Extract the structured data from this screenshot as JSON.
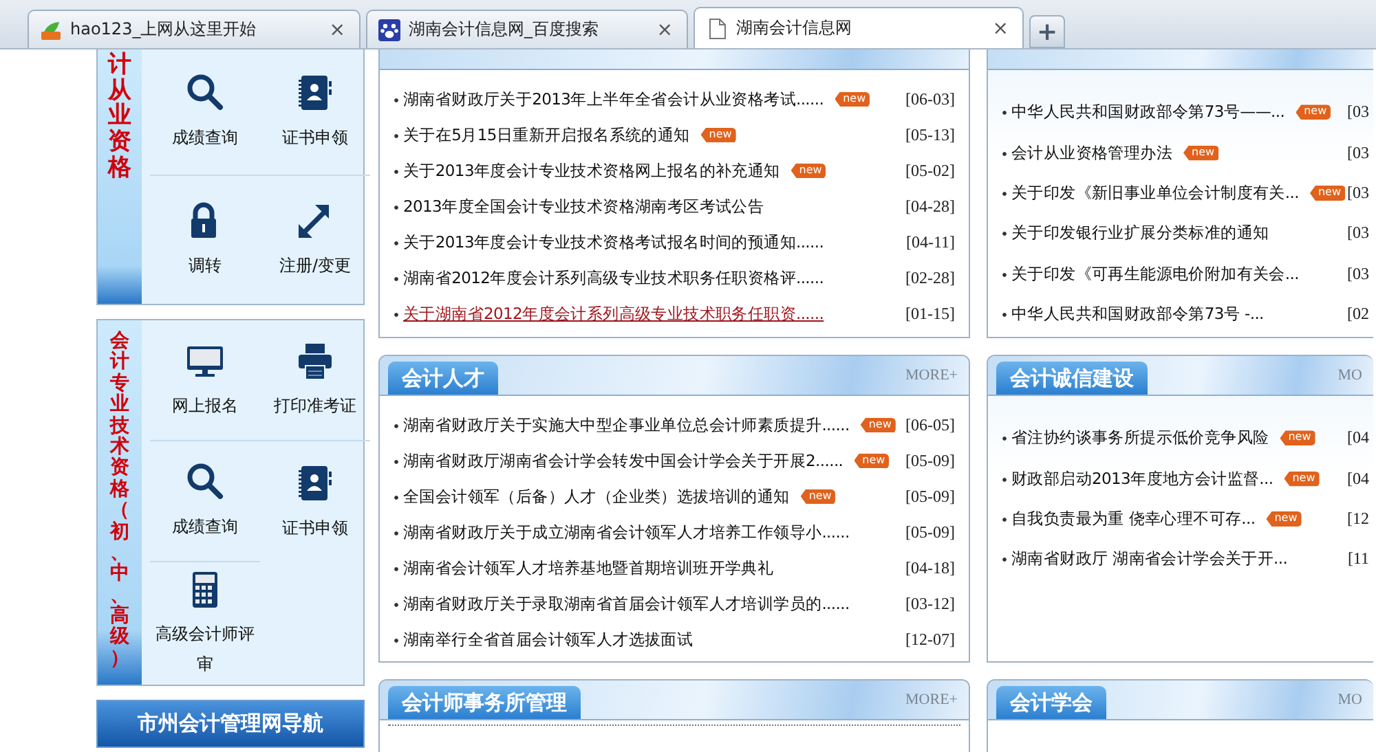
{
  "browser": {
    "tabs": [
      {
        "kind": "hao",
        "title": "hao123_上网从这里开始",
        "close": "×",
        "selected": false
      },
      {
        "kind": "paw",
        "title": "湖南会计信息网_百度搜索",
        "close": "×",
        "selected": false
      },
      {
        "kind": "page",
        "title": "湖南会计信息网",
        "close": "×",
        "selected": true
      }
    ],
    "new_tab": "+"
  },
  "sidebar": {
    "groups": [
      {
        "label": "计从业资格",
        "items": [
          {
            "kind": "search",
            "label": "成绩查询"
          },
          {
            "kind": "book",
            "label": "证书申领"
          },
          {
            "kind": "lock",
            "label": "调转"
          },
          {
            "kind": "arrows",
            "label": "注册/变更"
          }
        ]
      },
      {
        "label": "会计专业技术资格（初、中、高级）",
        "items": [
          {
            "kind": "monitor",
            "label": "网上报名"
          },
          {
            "kind": "printer",
            "label": "打印准考证"
          },
          {
            "kind": "search",
            "label": "成绩查询"
          },
          {
            "kind": "book",
            "label": "证书申领"
          },
          {
            "kind": "calculator",
            "label": "高级会计师评审"
          }
        ]
      }
    ],
    "nav_title": "市州会计管理网导航"
  },
  "columns": [
    {
      "panels": [
        {
          "items": [
            {
              "text": "湖南省财政厅关于2013年上半年全省会计从业资格考试......",
              "tag": "new",
              "date": "[06-03]",
              "active": false
            },
            {
              "text": "关于在5月15日重新开启报名系统的通知",
              "tag": "new",
              "date": "[05-13]",
              "active": false
            },
            {
              "text": "关于2013年度会计专业技术资格网上报名的补充通知",
              "tag": "new",
              "date": "[05-02]",
              "active": false
            },
            {
              "text": "2013年度全国会计专业技术资格湖南考区考试公告",
              "date": "[04-28]",
              "active": false
            },
            {
              "text": "关于2013年度会计专业技术资格考试报名时间的预通知......",
              "date": "[04-11]",
              "active": false
            },
            {
              "text": "湖南省2012年度会计系列高级专业技术职务任职资格评......",
              "date": "[02-28]",
              "active": false
            },
            {
              "text": "关于湖南省2012年度会计系列高级专业技术职务任职资......",
              "date": "[01-15]",
              "active": true
            }
          ]
        },
        {
          "title": "会计人才",
          "more": "MORE+",
          "items": [
            {
              "text": "湖南省财政厅关于实施大中型企事业单位总会计师素质提升......",
              "tag": "new",
              "date": "[06-05]"
            },
            {
              "text": "湖南省财政厅湖南省会计学会转发中国会计学会关于开展2......",
              "tag": "new",
              "date": "[05-09]"
            },
            {
              "text": "全国会计领军（后备）人才（企业类）选拔培训的通知",
              "tag": "new",
              "date": "[05-09]"
            },
            {
              "text": "湖南省财政厅关于成立湖南省会计领军人才培养工作领导小......",
              "date": "[05-09]"
            },
            {
              "text": "湖南省会计领军人才培养基地暨首期培训班开学典礼",
              "date": "[04-18]"
            },
            {
              "text": "湖南省财政厅关于录取湖南省首届会计领军人才培训学员的......",
              "date": "[03-12]"
            },
            {
              "text": "湖南举行全省首届会计领军人才选拔面试",
              "date": "[12-07]"
            }
          ]
        },
        {
          "title": "会计师事务所管理",
          "more": "MORE+"
        }
      ]
    },
    {
      "panels": [
        {
          "items": [
            {
              "text": "中华人民共和国财政部令第73号——...",
              "tag": "new",
              "date": "[03"
            },
            {
              "text": "会计从业资格管理办法",
              "tag": "new",
              "date": "[03"
            },
            {
              "text": "关于印发《新旧事业单位会计制度有关...",
              "tag": "new",
              "date": "[03"
            },
            {
              "text": "关于印发银行业扩展分类标准的通知",
              "date": "[03"
            },
            {
              "text": "关于印发《可再生能源电价附加有关会...",
              "date": "[03"
            },
            {
              "text": "中华人民共和国财政部令第73号 -...",
              "date": "[02"
            }
          ]
        },
        {
          "title": "会计诚信建设",
          "more": "MO",
          "items": [
            {
              "text": "省注协约谈事务所提示低价竞争风险",
              "tag": "new",
              "date": "[04"
            },
            {
              "text": "财政部启动2013年度地方会计监督...",
              "tag": "new",
              "date": "[04"
            },
            {
              "text": "自我负责最为重 侥幸心理不可存...",
              "tag": "new",
              "date": "[12"
            },
            {
              "text": "湖南省财政厅 湖南省会计学会关于开...",
              "date": "[11"
            }
          ]
        },
        {
          "title": "会计学会",
          "more": "MO"
        }
      ]
    }
  ]
}
